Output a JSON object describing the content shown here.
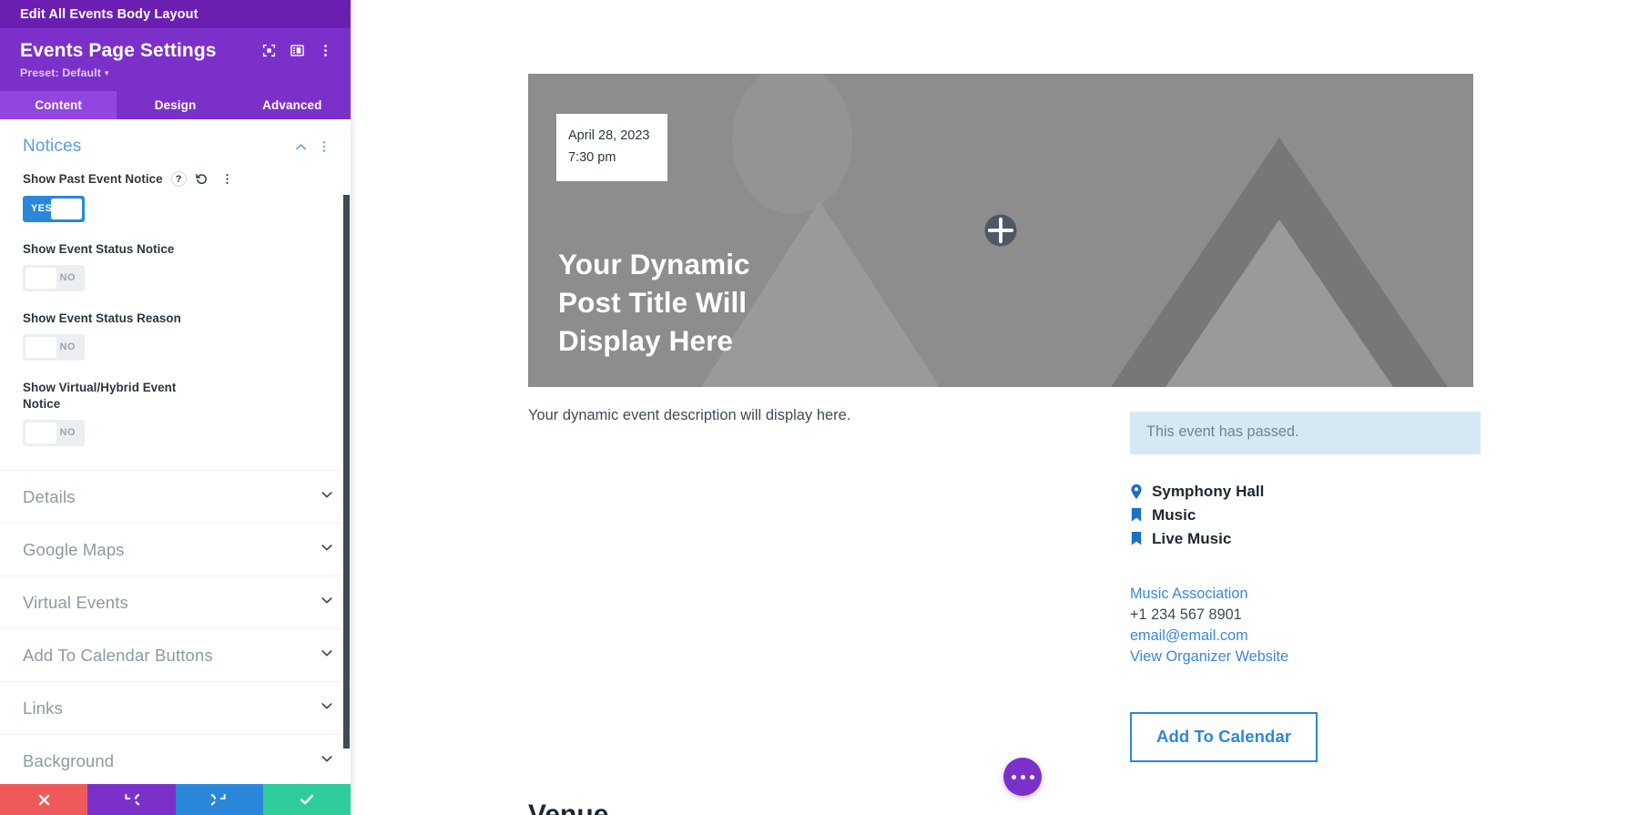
{
  "panel": {
    "breadcrumb": "Edit All Events Body Layout",
    "title": "Events Page Settings",
    "preset": "Preset: Default",
    "header_icons": [
      {
        "name": "focus-icon"
      },
      {
        "name": "panel-layout-icon"
      },
      {
        "name": "more-options-icon"
      }
    ],
    "tabs": [
      {
        "label": "Content",
        "active": true
      },
      {
        "label": "Design",
        "active": false
      },
      {
        "label": "Advanced",
        "active": false
      }
    ],
    "section": {
      "title": "Notices",
      "collapse_icon": "chevron-up-icon",
      "menu_icon": "more-options-icon",
      "fields": [
        {
          "label": "Show Past Event Notice",
          "value": "YES",
          "state": "on",
          "icons": [
            "help-icon",
            "reset-icon",
            "more-options-icon"
          ]
        },
        {
          "label": "Show Event Status Notice",
          "value": "NO",
          "state": "off",
          "icons": []
        },
        {
          "label": "Show Event Status Reason",
          "value": "NO",
          "state": "off",
          "icons": []
        },
        {
          "label": "Show Virtual/Hybrid Event Notice",
          "value": "NO",
          "state": "off",
          "icons": []
        }
      ]
    },
    "accordions": [
      {
        "label": "Details",
        "icon": "chevron-down-icon"
      },
      {
        "label": "Google Maps",
        "icon": "chevron-down-icon"
      },
      {
        "label": "Virtual Events",
        "icon": "chevron-down-icon"
      },
      {
        "label": "Add To Calendar Buttons",
        "icon": "chevron-down-icon"
      },
      {
        "label": "Links",
        "icon": "chevron-down-icon"
      },
      {
        "label": "Background",
        "icon": "chevron-down-icon"
      }
    ],
    "actions": [
      {
        "name": "cancel-button",
        "icon": "close-icon",
        "color": "#ee5a5a"
      },
      {
        "name": "undo-button",
        "icon": "undo-icon",
        "color": "#7b31c9"
      },
      {
        "name": "redo-button",
        "icon": "redo-icon",
        "color": "#2b87da"
      },
      {
        "name": "save-button",
        "icon": "check-icon",
        "color": "#2ecc9b"
      }
    ]
  },
  "canvas": {
    "hero": {
      "date": "April 28, 2023",
      "time": "7:30 pm",
      "title_line1": "Your Dynamic",
      "title_line2": "Post Title Will",
      "title_line3": "Display Here",
      "add_icon": "plus-icon"
    },
    "description": "Your dynamic event description will display here.",
    "passed_notice": "This event has passed.",
    "meta": [
      {
        "icon": "map-pin-icon",
        "label": "Symphony Hall"
      },
      {
        "icon": "bookmark-icon",
        "label": "Music"
      },
      {
        "icon": "bookmark-icon",
        "label": "Live Music"
      }
    ],
    "organizer": [
      {
        "text": "Music Association",
        "link": true
      },
      {
        "text": "+1 234 567 8901",
        "link": false
      },
      {
        "text": "email@email.com",
        "link": true
      },
      {
        "text": "View Organizer Website",
        "link": true
      }
    ],
    "calendar_button": "Add To Calendar",
    "float_button_icon": "ellipsis-icon",
    "below_fold_text": "Venue"
  },
  "colors": {
    "brand_purple": "#7b31c9",
    "breadcrumb_purple": "#6b1fb1",
    "tab_active": "#9246e0",
    "accent_blue": "#2b87da",
    "link_blue": "#3b87d8",
    "notice_bg": "#d4e9f4",
    "hero_gray": "#8d8d8d",
    "save_green": "#2ecc9b",
    "cancel_red": "#ee5a5a"
  }
}
